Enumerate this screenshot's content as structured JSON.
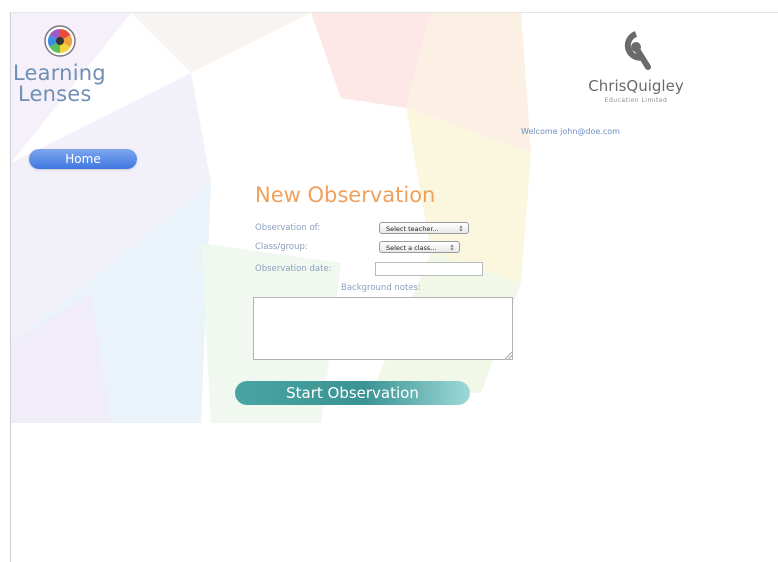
{
  "brand": {
    "line1": "Learning",
    "line2": "Lenses",
    "icon": "aperture-icon"
  },
  "company": {
    "name": "ChrisQuigley",
    "subtitle": "Education Limited",
    "icon": "q-logo-icon"
  },
  "header": {
    "welcome": "Welcome john@doe.com"
  },
  "nav": {
    "home_label": "Home"
  },
  "form": {
    "title": "New Observation",
    "observation_of_label": "Observation of:",
    "teacher_select_value": "Select teacher...",
    "class_group_label": "Class/group:",
    "class_select_value": "Select a class...",
    "observation_date_label": "Observation date:",
    "observation_date_value": "",
    "background_notes_label": "Background notes:",
    "background_notes_value": "",
    "start_label": "Start Observation"
  },
  "colors": {
    "home_button": "#4a7fe3",
    "title": "#f0a05c",
    "start_button": "#3a9393",
    "labels": "#8a9fbf"
  }
}
